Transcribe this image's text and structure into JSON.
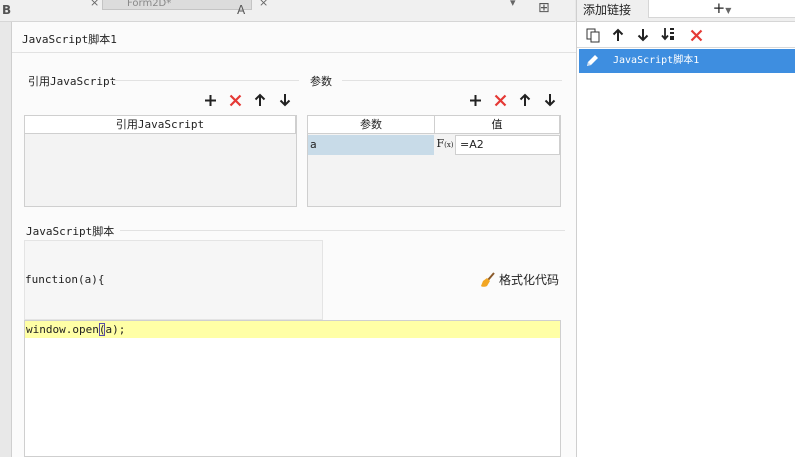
{
  "background_app": {
    "toolbar_glyphs": [
      "B",
      "A"
    ],
    "tab_label": "Form2D*"
  },
  "dialog": {
    "title": "JavaScript脚本1",
    "referenced": {
      "label": "引用JavaScript",
      "column_header": "引用JavaScript",
      "rows": []
    },
    "params": {
      "label": "参数",
      "column_headers": [
        "参数",
        "值"
      ],
      "rows": [
        {
          "name": "a",
          "formula_button": "F",
          "formula_sub": "(x)",
          "value": "=A2"
        }
      ]
    },
    "script": {
      "label": "JavaScript脚本",
      "function_signature": "function(a){",
      "format_button_label": "格式化代码",
      "code_before_paren": "window.open",
      "code_paren": "(",
      "code_after_paren": "a);"
    }
  },
  "right_panel": {
    "add_link_label": "添加链接",
    "add_button_label": "+",
    "links": [
      {
        "label": "JavaScript脚本1",
        "selected": true
      }
    ]
  },
  "colors": {
    "delete_red": "#e53935",
    "selection_blue": "#3e8ee0",
    "param_cell_blue": "#c8dbe8",
    "code_highlight_yellow": "#ffffa6"
  }
}
